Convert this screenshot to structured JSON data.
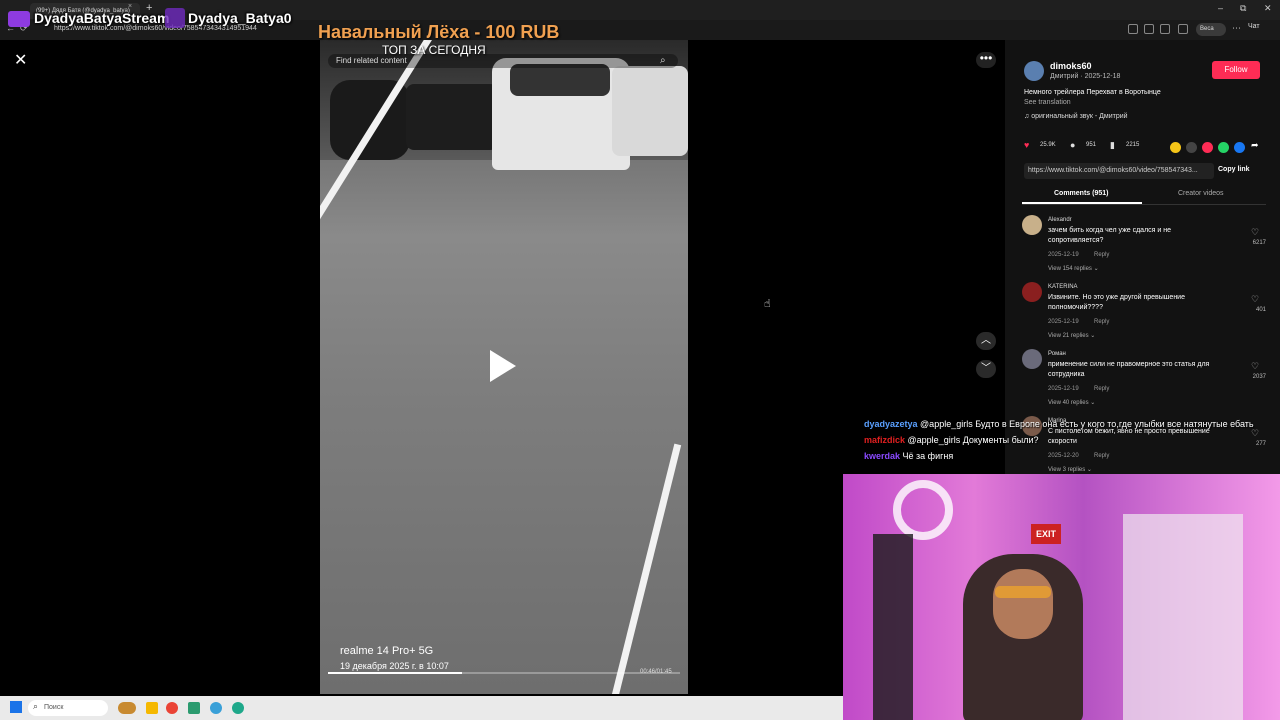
{
  "browser": {
    "tab_title": "(99+) Дядя Батя (@dyadya_batya)",
    "tab_close": "×",
    "new_tab": "+",
    "url": "https://www.tiktok.com/@dimoks60/video/7585473434314951944",
    "window_controls": [
      "–",
      "⧉",
      "✕"
    ],
    "profile_label": "Веса",
    "copilot_label": "Чат"
  },
  "stream": {
    "channel_name": "DyadyaBatyaStream",
    "handle": "Dyadya_Batya0",
    "donation_banner": "Навальный Лёха - 100 RUB"
  },
  "video": {
    "overlay_title": "ТОП ЗА СЕГОДНЯ",
    "search_placeholder": "Find related content",
    "device_label": "realme 14 Pro+ 5G",
    "date_label": "19 декабря 2025 г. в 10:07",
    "timecode": "00:46/01:45",
    "progress_fraction": 0.38
  },
  "controls": {
    "close": "✕",
    "more": "•••",
    "prev": "︿",
    "next": "﹀"
  },
  "post": {
    "username": "dimoks60",
    "subline": "Дмитрий · 2025-12-18",
    "follow_label": "Follow",
    "description": "Немного трейлера Перехват в Воротынце",
    "see_translation": "See translation",
    "sound": "♫ оригинальный звук - Дмитрий",
    "likes": "25.9K",
    "comments": "951",
    "saves": "2215",
    "link": "https://www.tiktok.com/@dimoks60/video/758547343...",
    "copy_link": "Copy link",
    "tab_comments": "Comments (951)",
    "tab_creator": "Creator videos"
  },
  "comments": [
    {
      "user": "Alexandr",
      "text": "зачем бить когда чел уже сдался и не сопротивляется?",
      "date": "2025-12-19",
      "reply": "Reply",
      "replies": "View 154 replies ⌄",
      "likes": "6217",
      "avatar_color": "#c8b08a"
    },
    {
      "user": "KATERINA",
      "text": "Извините. Но это уже другой превышение полномочий????",
      "date": "2025-12-19",
      "reply": "Reply",
      "replies": "View 21 replies ⌄",
      "likes": "401",
      "avatar_color": "#8a1f1f"
    },
    {
      "user": "Роман",
      "text": "применение сили не правомерное это статья для сотрудника",
      "date": "2025-12-19",
      "reply": "Reply",
      "replies": "View 40 replies ⌄",
      "likes": "2037",
      "avatar_color": "#6a6a7a"
    },
    {
      "user": "Marina",
      "text": "С пистолетом бежит, явно не просто превышение скорости",
      "date": "2025-12-20",
      "reply": "Reply",
      "replies": "View 3 replies ⌄",
      "likes": "277",
      "avatar_color": "#7a5a4a"
    }
  ],
  "chat": [
    {
      "user": "dyadyazetya",
      "message": "@apple_girls Будто в Европе она есть у кого то,где улыбки все натянутые ебать",
      "color": "#5aa0ff"
    },
    {
      "user": "mafizdick",
      "message": "@apple_girls Документы были?",
      "color": "#e02020"
    },
    {
      "user": "kwerdak",
      "message": "Чё за фигня",
      "color": "#8a4aff"
    }
  ],
  "webcam": {
    "exit_sign": "EXIT"
  },
  "taskbar": {
    "search_placeholder": "Поиск"
  },
  "colors": {
    "accent": "#fe2c55",
    "donation": "#f0a050",
    "stream_purple": "#8e3be0"
  }
}
